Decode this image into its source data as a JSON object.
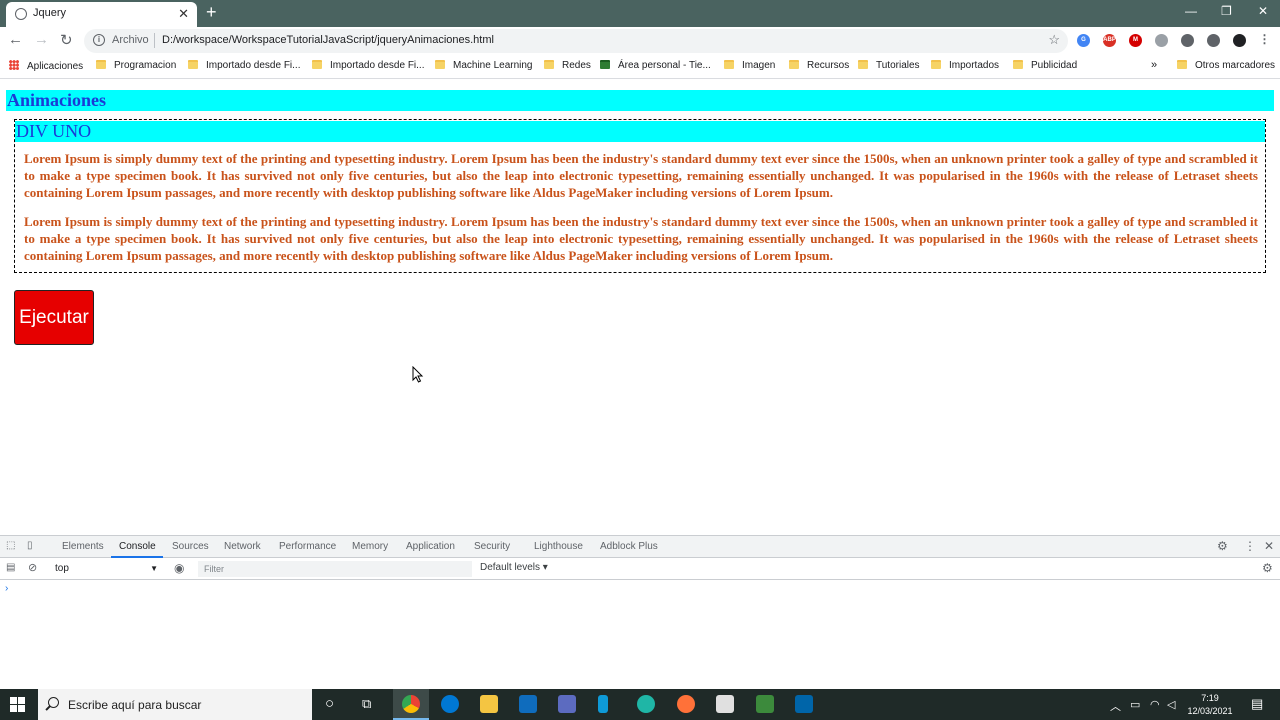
{
  "browser": {
    "tab_title": "Jquery",
    "new_tab": "+",
    "scheme_label": "Archivo",
    "url": "D:/workspace/WorkspaceTutorialJavaScript/jqueryAnimaciones.html",
    "bookmarks": [
      "Aplicaciones",
      "Programacion",
      "Importado desde Fi...",
      "Importado desde Fi...",
      "Machine Learning",
      "Redes",
      "Área personal - Tie...",
      "Imagen",
      "Recursos",
      "Tutoriales",
      "Importados",
      "Publicidad"
    ],
    "more_bookmarks": "»",
    "other_bookmarks": "Otros marcadores"
  },
  "page": {
    "heading": "Animaciones",
    "div_title": "DIV UNO",
    "paragraphs": [
      "Lorem Ipsum is simply dummy text of the printing and typesetting industry. Lorem Ipsum has been the industry's standard dummy text ever since the 1500s, when an unknown printer took a galley of type and scrambled it to make a type specimen book. It has survived not only five centuries, but also the leap into electronic typesetting, remaining essentially unchanged. It was popularised in the 1960s with the release of Letraset sheets containing Lorem Ipsum passages, and more recently with desktop publishing software like Aldus PageMaker including versions of Lorem Ipsum.",
      "Lorem Ipsum is simply dummy text of the printing and typesetting industry. Lorem Ipsum has been the industry's standard dummy text ever since the 1500s, when an unknown printer took a galley of type and scrambled it to make a type specimen book. It has survived not only five centuries, but also the leap into electronic typesetting, remaining essentially unchanged. It was popularised in the 1960s with the release of Letraset sheets containing Lorem Ipsum passages, and more recently with desktop publishing software like Aldus PageMaker including versions of Lorem Ipsum."
    ],
    "button_label": "Ejecutar"
  },
  "devtools": {
    "tabs": [
      "Elements",
      "Console",
      "Sources",
      "Network",
      "Performance",
      "Memory",
      "Application",
      "Security",
      "Lighthouse",
      "Adblock Plus"
    ],
    "active_tab": "Console",
    "context": "top",
    "filter_placeholder": "Filter",
    "levels": "Default levels ▾",
    "prompt": "›"
  },
  "taskbar": {
    "search_placeholder": "Escribe aquí para buscar",
    "time": "7:19",
    "date": "12/03/2021"
  },
  "colors": {
    "heading_bg": "#00ffff",
    "heading_text": "#1a3bd6",
    "lorem_text": "#c9531b",
    "button_bg": "#e60000"
  }
}
